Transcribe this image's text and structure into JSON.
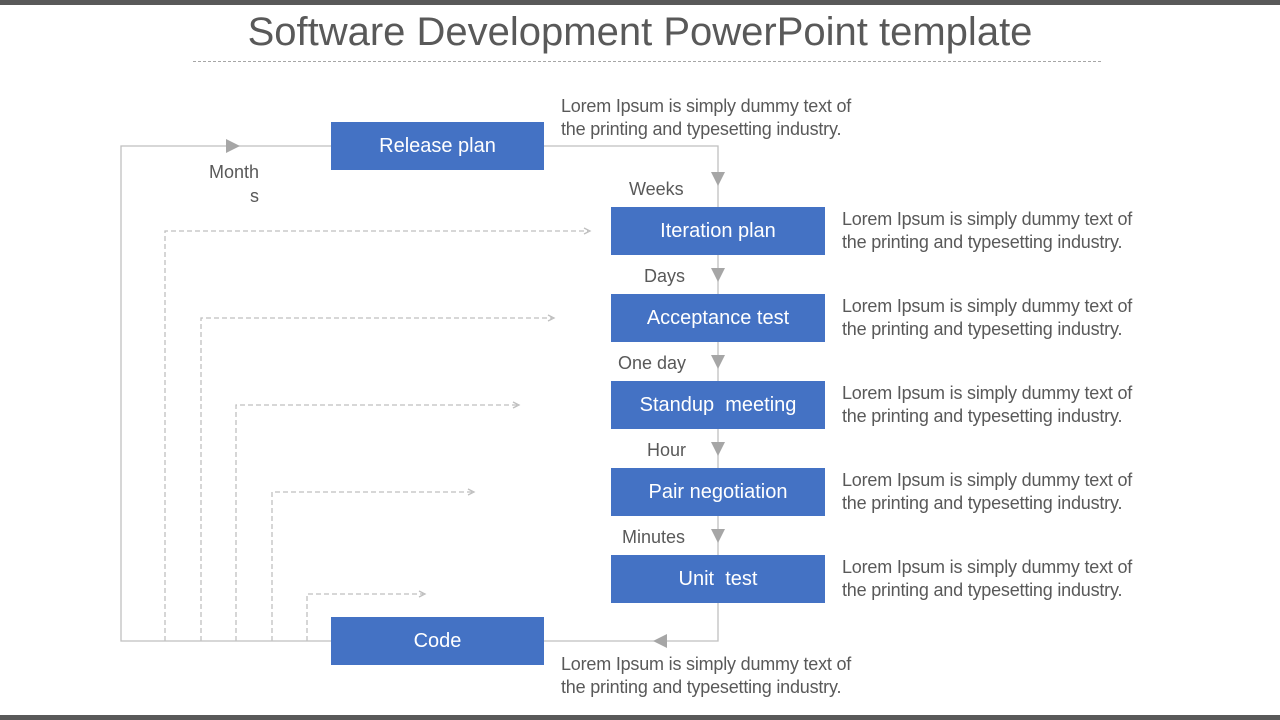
{
  "slide": {
    "title": "Software Development PowerPoint template",
    "colors": {
      "box": "#4472c4",
      "text": "#595959",
      "bar": "#595959",
      "line": "#bfbfbf",
      "arrow": "#a6a6a6"
    }
  },
  "diagram": {
    "steps": [
      {
        "label": "Release plan",
        "desc1": "Lorem Ipsum is simply dummy text of",
        "desc2": "the printing and typesetting industry."
      },
      {
        "label": "Iteration plan",
        "desc1": "Lorem Ipsum is simply dummy text of",
        "desc2": "the printing and typesetting industry."
      },
      {
        "label": "Acceptance test",
        "desc1": "Lorem Ipsum is simply dummy text of",
        "desc2": "the printing and typesetting industry."
      },
      {
        "label": "Standup  meeting",
        "desc1": "Lorem Ipsum is simply dummy text of",
        "desc2": "the printing and typesetting industry."
      },
      {
        "label": "Pair negotiation",
        "desc1": "Lorem Ipsum is simply dummy text of",
        "desc2": "the printing and typesetting industry."
      },
      {
        "label": "Unit  test",
        "desc1": "Lorem Ipsum is simply dummy text of",
        "desc2": "the printing and typesetting industry."
      },
      {
        "label": "Code",
        "desc1": "Lorem Ipsum is simply dummy text of",
        "desc2": "the printing and typesetting industry."
      }
    ],
    "intervals": {
      "months_line1": "Month",
      "months_line2": "s",
      "weeks": "Weeks",
      "days": "Days",
      "one_day": "One day",
      "hour": "Hour",
      "minutes": "Minutes"
    }
  }
}
